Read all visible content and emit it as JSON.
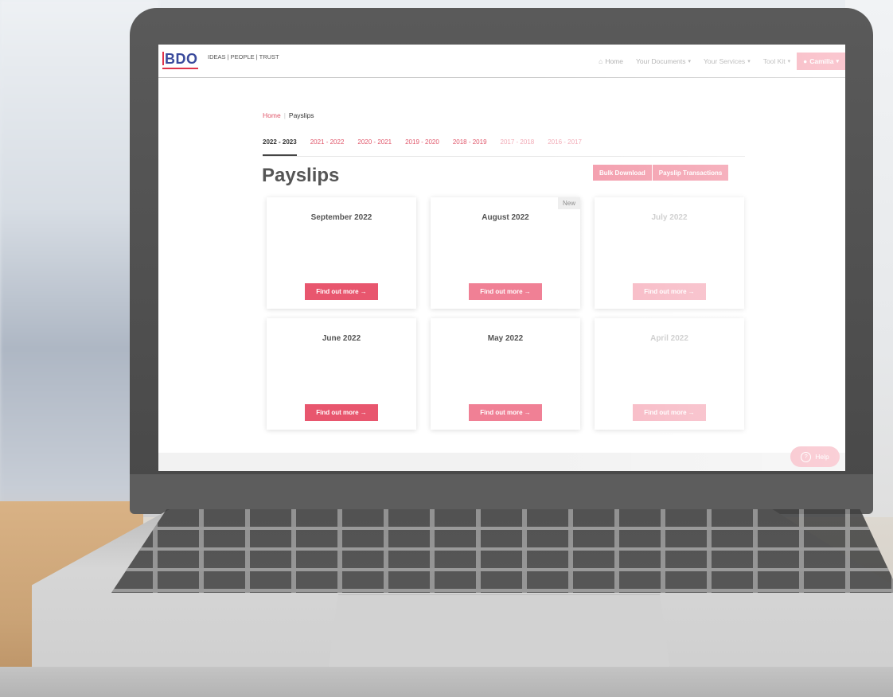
{
  "brand": {
    "logo_text": "BDO",
    "tagline": "IDEAS | PEOPLE | TRUST"
  },
  "nav": {
    "items": [
      {
        "label": "Home",
        "icon": "home-icon"
      },
      {
        "label": "Your Documents",
        "dropdown": true
      },
      {
        "label": "Your Services",
        "dropdown": true
      },
      {
        "label": "Tool Kit",
        "dropdown": true
      }
    ],
    "user": {
      "label": "Camilla",
      "icon": "user-icon"
    }
  },
  "breadcrumb": {
    "home": "Home",
    "separator": "|",
    "current": "Payslips"
  },
  "years": [
    "2022 - 2023",
    "2021 - 2022",
    "2020 - 2021",
    "2019 - 2020",
    "2018 - 2019",
    "2017 - 2018",
    "2016 - 2017"
  ],
  "page": {
    "title": "Payslips",
    "bulk_download": "Bulk Download",
    "payslip_transactions": "Payslip Transactions"
  },
  "cards": [
    {
      "month": "September 2022",
      "button": "Find out more →"
    },
    {
      "month": "August 2022",
      "button": "Find out more →",
      "badge": "New"
    },
    {
      "month": "July 2022",
      "button": "Find out more →"
    },
    {
      "month": "June 2022",
      "button": "Find out more →"
    },
    {
      "month": "May 2022",
      "button": "Find out more →"
    },
    {
      "month": "April 2022",
      "button": "Find out more →"
    }
  ],
  "help": {
    "label": "Help",
    "icon": "question-icon"
  },
  "colors": {
    "accent": "#e8566e",
    "brand_blue": "#3a4a9c"
  }
}
